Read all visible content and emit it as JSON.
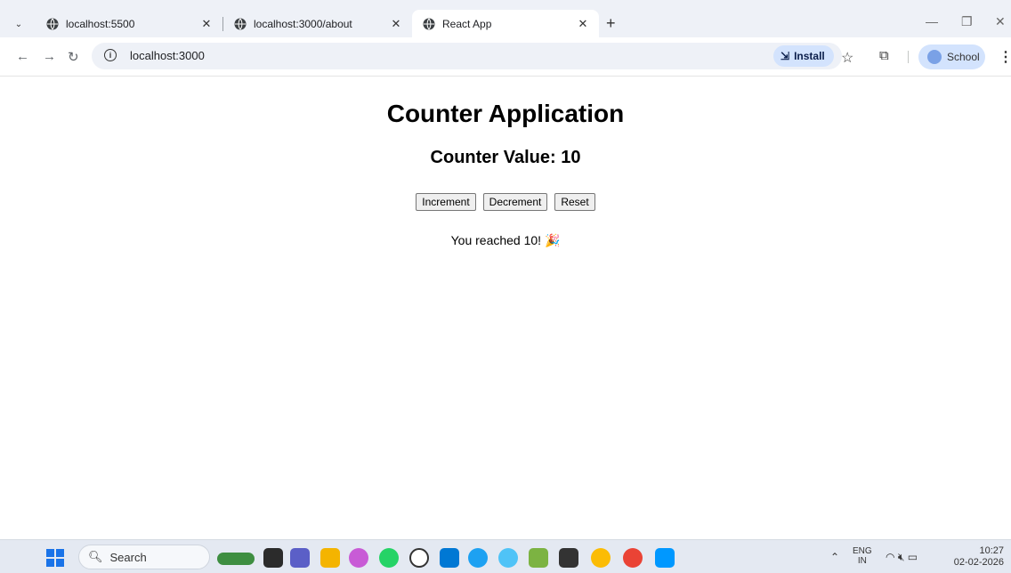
{
  "tabs": [
    {
      "title": "localhost:5500",
      "active": false
    },
    {
      "title": "localhost:3000/about",
      "active": false
    },
    {
      "title": "React App",
      "active": true
    }
  ],
  "toolbar": {
    "url": "localhost:3000",
    "install_label": "Install",
    "profile_label": "School"
  },
  "page": {
    "heading": "Counter Application",
    "counter_text": "Counter Value: 10",
    "increment_label": "Increment",
    "decrement_label": "Decrement",
    "reset_label": "Reset",
    "message": "You reached 10! 🎉"
  },
  "taskbar": {
    "search_label": "Search",
    "lang_line1": "ENG",
    "lang_line2": "IN",
    "time": "10:27",
    "date": "02-02-2026"
  },
  "colors": {
    "tabstrip_bg": "#eef1f7",
    "accent_chip": "#d3e3fd",
    "taskbar_bg": "#e4e9f2"
  }
}
